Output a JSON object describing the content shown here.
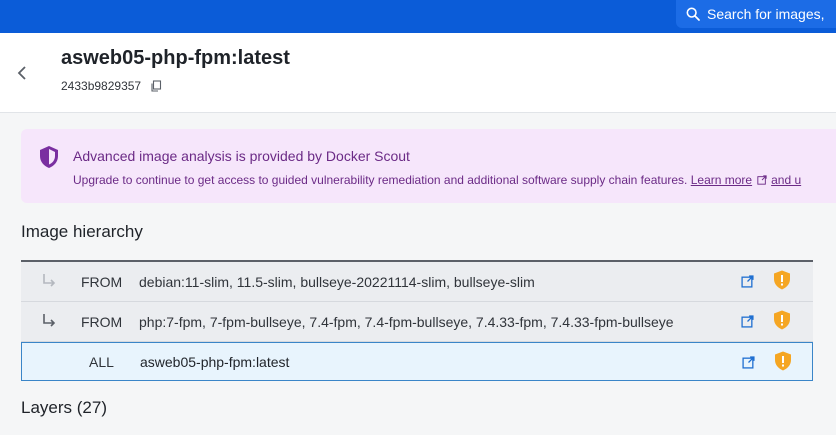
{
  "search": {
    "placeholder": "Search for images,"
  },
  "header": {
    "title": "asweb05-php-fpm:latest",
    "digest": "2433b9829357"
  },
  "banner": {
    "title": "Advanced image analysis is provided by Docker Scout",
    "text": "Upgrade to continue to get access to guided vulnerability remediation and additional software supply chain features.",
    "learn_more": "Learn more",
    "tail": "and u"
  },
  "hierarchy": {
    "heading": "Image hierarchy",
    "rows": [
      {
        "kind": "FROM",
        "tags": "debian:11-slim, 11.5-slim, bullseye-20221114-slim, bullseye-slim"
      },
      {
        "kind": "FROM",
        "tags": "php:7-fpm, 7-fpm-bullseye, 7.4-fpm, 7.4-fpm-bullseye, 7.4.33-fpm, 7.4.33-fpm-bullseye"
      },
      {
        "kind": "ALL",
        "tags": "asweb05-php-fpm:latest"
      }
    ]
  },
  "layers": {
    "heading": "Layers (27)"
  },
  "colors": {
    "topbar": "#0b5cd8",
    "banner_bg": "#f6e6fb",
    "banner_text": "#6b2a86",
    "warning": "#f5a623",
    "link": "#1f6fd1"
  },
  "icons": {
    "search": "search-icon",
    "back": "chevron-left-icon",
    "copy": "copy-icon",
    "shield": "shield-icon",
    "external": "external-link-icon",
    "warning": "warning-shield-icon",
    "arrow": "corner-down-right-icon"
  }
}
